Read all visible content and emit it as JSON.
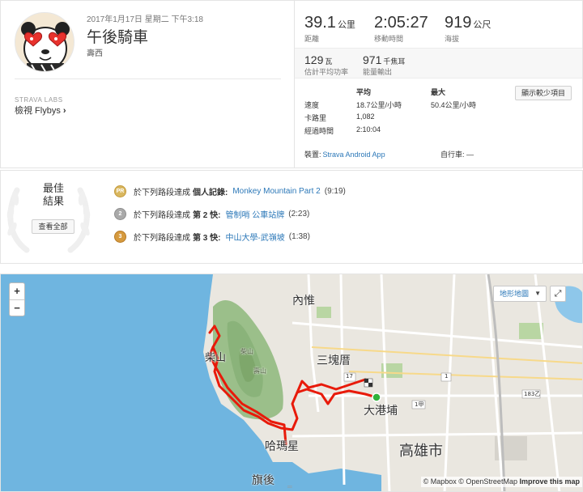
{
  "activity": {
    "date": "2017年1月17日 星期二 下午3:18",
    "title": "午後騎車",
    "location": "壽西",
    "labs_tag": "STRAVA LABS",
    "flybys_label": "檢視 Flybys",
    "flybys_chevron": "›"
  },
  "stats": {
    "distance": {
      "value": "39.1",
      "unit": "公里",
      "label": "距離"
    },
    "moving_time": {
      "value": "2:05:27",
      "label": "移動時間"
    },
    "elevation": {
      "value": "919",
      "unit": "公尺",
      "label": "海拔"
    },
    "power": {
      "value": "129",
      "unit": "瓦",
      "label": "估計平均功率"
    },
    "energy": {
      "value": "971",
      "unit": "千焦耳",
      "label": "能量輸出"
    }
  },
  "more_button": "顯示較少項目",
  "stats_table": {
    "header_avg": "平均",
    "header_max": "最大",
    "rows": [
      {
        "label": "速度",
        "avg": "18.7公里/小時",
        "max": "50.4公里/小時"
      },
      {
        "label": "卡路里",
        "avg": "1,082",
        "max": ""
      },
      {
        "label": "經過時間",
        "avg": "2:10:04",
        "max": ""
      }
    ]
  },
  "device": {
    "label": "裝置:",
    "value": "Strava Android App"
  },
  "bike": {
    "label": "自行車:",
    "value": "—"
  },
  "best_results": {
    "title_line1": "最佳",
    "title_line2": "結果",
    "see_all": "查看全部",
    "items": [
      {
        "medal": "PR",
        "prefix": "於下列路段達成",
        "rank": "個人記錄:",
        "segment": "Monkey Mountain Part 2",
        "time": "(9:19)"
      },
      {
        "medal": "2",
        "prefix": "於下列路段達成",
        "rank": "第 2 快:",
        "segment": "管制哨 公車站牌",
        "time": "(2:23)"
      },
      {
        "medal": "3",
        "prefix": "於下列路段達成",
        "rank": "第 3 快:",
        "segment": "中山大學-武嶺坡",
        "time": "(1:38)"
      }
    ]
  },
  "map": {
    "zoom_in": "+",
    "zoom_out": "−",
    "map_type": "地形地圖",
    "map_type_caret": "▼",
    "fullscreen_icon": "⤢",
    "attribution_mapbox": "© Mapbox",
    "attribution_osm": "© OpenStreetMap",
    "attribution_improve": "Improve this map",
    "drag_handle": "═",
    "labels": {
      "neiwei": "內惟",
      "chaishan": "柴山",
      "sankuaicuo": "三塊厝",
      "dagangpu": "大港埔",
      "hamaxing": "哈瑪星",
      "kaohsiung": "高雄市",
      "qihou": "旗後",
      "chaishan_peak": "柴山",
      "shoushan_peak": "壽山",
      "road17": "17",
      "road1a": "1甲",
      "road183": "183乙",
      "road1": "1"
    },
    "colors": {
      "route": "#e81a0a",
      "sea": "#6fb5e0",
      "land": "#eae7e0",
      "hill": "#9bbf8a",
      "start": "#2fb23a"
    }
  }
}
